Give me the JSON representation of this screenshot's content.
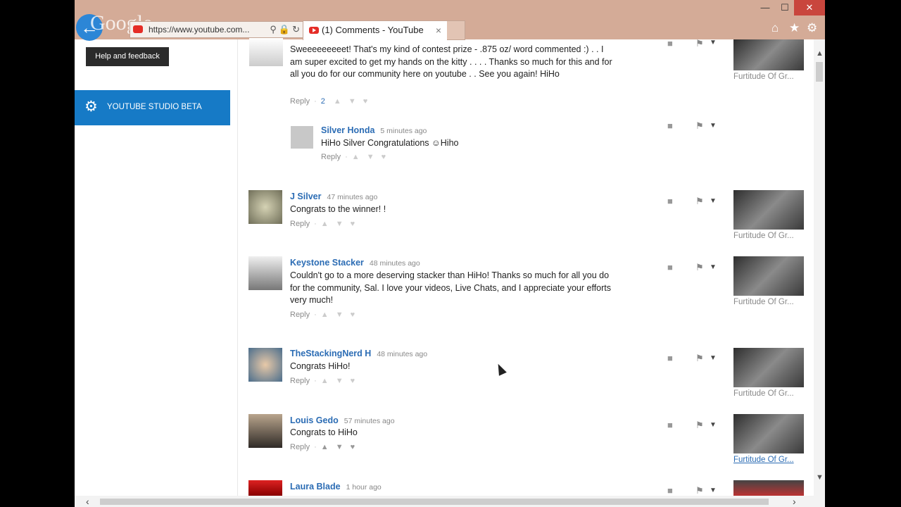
{
  "browser": {
    "logo_text": "Google",
    "url": "https://www.youtube.com...",
    "tab_title": "(1) Comments - YouTube",
    "tab_close": "×",
    "window_controls": {
      "minimize": "—",
      "maximize": "☐",
      "close": "✕"
    },
    "nav_icons": {
      "home": "⌂",
      "favorites": "★",
      "settings": "⚙"
    }
  },
  "sidebar": {
    "tooltip": "Help and feedback",
    "studio_label": "YOUTUBE STUDIO BETA"
  },
  "comments": [
    {
      "author": "",
      "time": "",
      "text": "Sweeeeeeeeet!  That's my kind of contest prize  - .875 oz/ word commented :) . .   I am super excited to get my hands on the kitty . . . . Thanks so much for this and for all you do for our community here on youtube . .  See you again! HiHo",
      "reply": "Reply",
      "reply_count": "2",
      "video_label": "Furtitude Of Gr...",
      "video_link": false
    },
    {
      "author": "Silver Honda",
      "time": "5 minutes ago",
      "text": "HiHo Silver   Congratulations ☺Hiho",
      "reply": "Reply",
      "reply_count": "",
      "video_label": "",
      "video_link": false
    },
    {
      "author": "J Silver",
      "time": "47 minutes ago",
      "text": "Congrats to the winner! !",
      "reply": "Reply",
      "reply_count": "",
      "video_label": "Furtitude Of Gr...",
      "video_link": false
    },
    {
      "author": "Keystone Stacker",
      "time": "48 minutes ago",
      "text": "Couldn't go to a more deserving stacker than HiHo!  Thanks so much for all you do for the community, Sal.  I love your videos, Live Chats, and I appreciate your efforts very much!",
      "reply": "Reply",
      "reply_count": "",
      "video_label": "Furtitude Of Gr...",
      "video_link": false
    },
    {
      "author": "TheStackingNerd H",
      "time": "48 minutes ago",
      "text": "Congrats HiHo!",
      "reply": "Reply",
      "reply_count": "",
      "video_label": "Furtitude Of Gr...",
      "video_link": false
    },
    {
      "author": "Louis Gedo",
      "time": "57 minutes ago",
      "text": "Congrats to HiHo",
      "reply": "Reply",
      "reply_count": "",
      "video_label": "Furtitude Of Gr...",
      "video_link": true
    },
    {
      "author": "Laura Blade",
      "time": "1 hour ago",
      "text": "",
      "reply": "",
      "reply_count": "",
      "video_label": "",
      "video_link": false
    }
  ],
  "colors": {
    "titlebar": "#d4ab97",
    "studio_bg": "#167ac6",
    "link": "#2b6cb4",
    "close_btn": "#c9463d"
  }
}
